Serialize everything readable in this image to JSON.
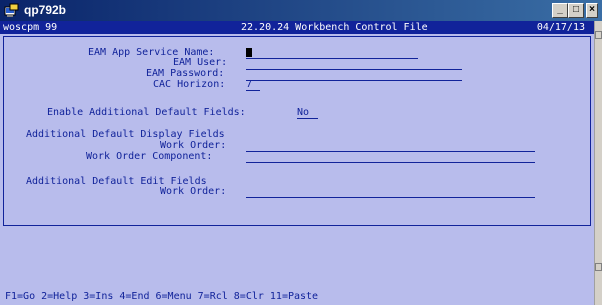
{
  "window": {
    "title": "qp792b",
    "buttons": {
      "minimize": "_",
      "maximize": "□",
      "close": "×"
    }
  },
  "header": {
    "left": "woscpm 99",
    "center": "22.20.24 Workbench Control File",
    "right": "04/17/13"
  },
  "form": {
    "eam_app_service_name_label": "EAM App Service Name:",
    "eam_user_label": "EAM User:",
    "eam_password_label": "EAM Password:",
    "cac_horizon_label": "CAC Horizon:",
    "cac_horizon_value": "7",
    "enable_additional_label": "Enable Additional Default Fields:",
    "enable_additional_value": "No",
    "display_section_title": "Additional Default Display Fields",
    "display_work_order_label": "Work Order:",
    "display_work_order_component_label": "Work Order Component:",
    "edit_section_title": "Additional Default Edit Fields",
    "edit_work_order_label": "Work Order:"
  },
  "footer": {
    "function_keys": "F1=Go 2=Help 3=Ins 4=End 6=Menu 7=Rcl 8=Clr 11=Paste"
  },
  "colors": {
    "terminal_bg": "#b8bcec",
    "terminal_fg": "#11239a",
    "header_bg": "#11239a",
    "titlebar": "#0a246a"
  }
}
